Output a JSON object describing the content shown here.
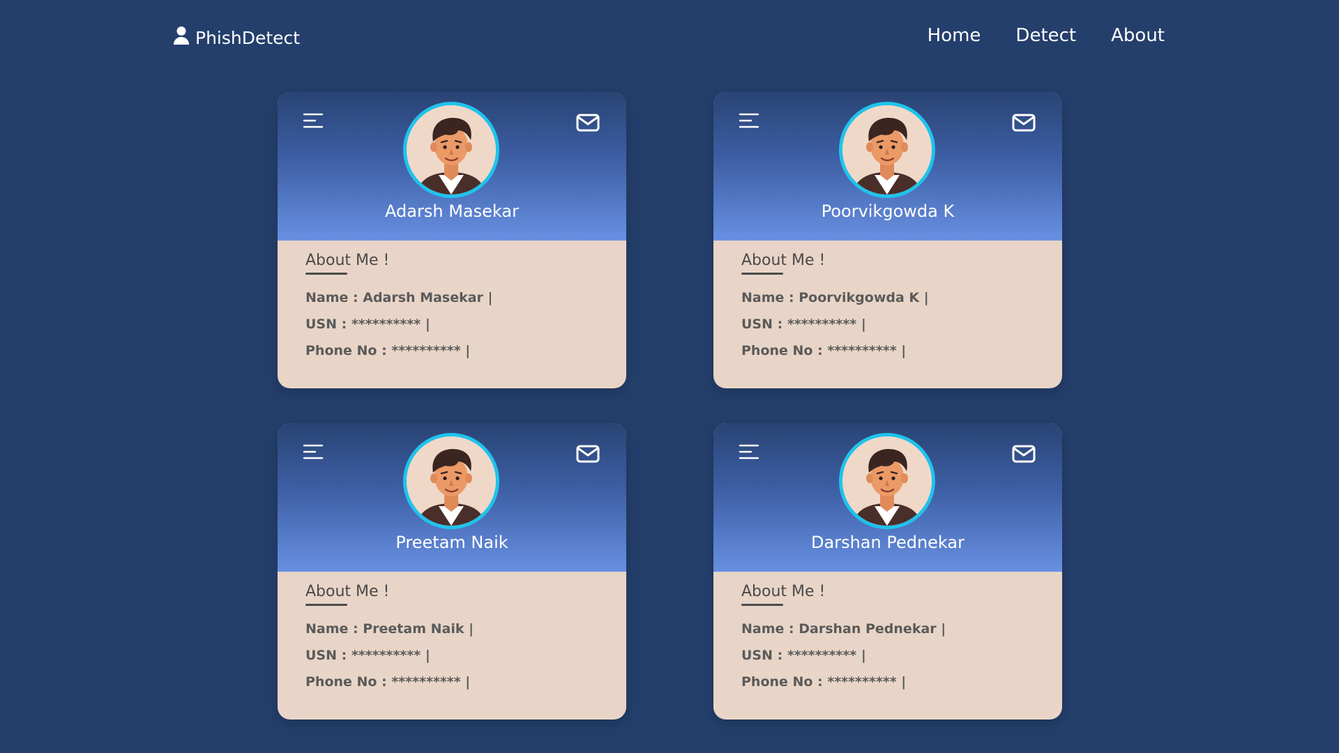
{
  "nav": {
    "brand": "PhishDetect",
    "links": [
      "Home",
      "Detect",
      "About"
    ]
  },
  "colors": {
    "background": "#243f6c",
    "avatar_ring": "#1fc3ec",
    "card_body": "#e8d5c7"
  },
  "cards": [
    {
      "name": "Adarsh Masekar",
      "about_title": "About Me !",
      "name_row": "Name : Adarsh Masekar |",
      "usn_row": "USN : ********** |",
      "phone_row": "Phone No : ********** |"
    },
    {
      "name": "Poorvikgowda K",
      "about_title": "About Me !",
      "name_row": "Name : Poorvikgowda K |",
      "usn_row": "USN : ********** |",
      "phone_row": "Phone No : ********** |"
    },
    {
      "name": "Preetam Naik",
      "about_title": "About Me !",
      "name_row": "Name : Preetam Naik |",
      "usn_row": "USN : ********** |",
      "phone_row": "Phone No : ********** |"
    },
    {
      "name": "Darshan Pednekar",
      "about_title": "About Me !",
      "name_row": "Name : Darshan Pednekar |",
      "usn_row": "USN : ********** |",
      "phone_row": "Phone No : ********** |"
    }
  ],
  "icons": {
    "brand": "user-icon",
    "menu": "menu-icon",
    "mail": "mail-icon",
    "avatar": "avatar-illustration"
  }
}
